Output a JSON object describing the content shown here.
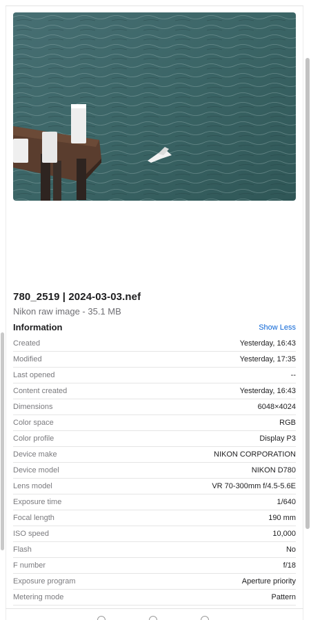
{
  "file": {
    "name": "780_2519 | 2024-03-03.nef",
    "subtitle": "Nikon raw image - 35.1 MB"
  },
  "info": {
    "header": "Information",
    "toggle_label": "Show Less",
    "rows": [
      {
        "key": "Created",
        "value": "Yesterday, 16:43"
      },
      {
        "key": "Modified",
        "value": "Yesterday, 17:35"
      },
      {
        "key": "Last opened",
        "value": "--"
      },
      {
        "key": "Content created",
        "value": "Yesterday, 16:43"
      },
      {
        "key": "Dimensions",
        "value": "6048×4024"
      },
      {
        "key": "Color space",
        "value": "RGB"
      },
      {
        "key": "Color profile",
        "value": "Display P3"
      },
      {
        "key": "Device make",
        "value": "NIKON CORPORATION"
      },
      {
        "key": "Device model",
        "value": "NIKON D780"
      },
      {
        "key": "Lens model",
        "value": "VR 70-300mm f/4.5-5.6E"
      },
      {
        "key": "Exposure time",
        "value": "1/640"
      },
      {
        "key": "Focal length",
        "value": "190 mm"
      },
      {
        "key": "ISO speed",
        "value": "10,000"
      },
      {
        "key": "Flash",
        "value": "No"
      },
      {
        "key": "F number",
        "value": "f/18"
      },
      {
        "key": "Exposure program",
        "value": "Aperture priority"
      },
      {
        "key": "Metering mode",
        "value": "Pattern"
      }
    ]
  },
  "colors": {
    "accent": "#0a64d6",
    "water": "#3c6668"
  },
  "bottom_icons": [
    "share-icon",
    "tag-icon",
    "more-icon"
  ]
}
